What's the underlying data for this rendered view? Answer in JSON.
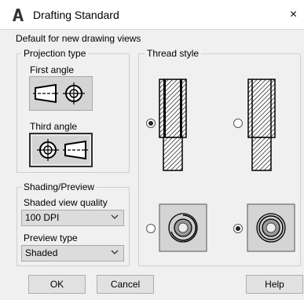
{
  "window": {
    "title": "Drafting Standard",
    "close_label": "×"
  },
  "section_title": "Default for new drawing views",
  "projection": {
    "legend": "Projection type",
    "first_angle_label": "First angle",
    "third_angle_label": "Third angle",
    "selected": "third"
  },
  "shading": {
    "legend": "Shading/Preview",
    "quality_label": "Shaded view quality",
    "quality_value": "100 DPI",
    "preview_label": "Preview type",
    "preview_value": "Shaded"
  },
  "thread": {
    "legend": "Thread style",
    "options": [
      {
        "name": "thread-option-1",
        "checked": true
      },
      {
        "name": "thread-option-2",
        "checked": false
      },
      {
        "name": "thread-end-option-1",
        "checked": false
      },
      {
        "name": "thread-end-option-2",
        "checked": true
      }
    ]
  },
  "buttons": {
    "ok": "OK",
    "cancel": "Cancel",
    "help": "Help"
  },
  "colors": {
    "dialog_bg": "#f0f0f0",
    "image_bg": "#d4d4d4",
    "title_bg": "#ffffff"
  }
}
